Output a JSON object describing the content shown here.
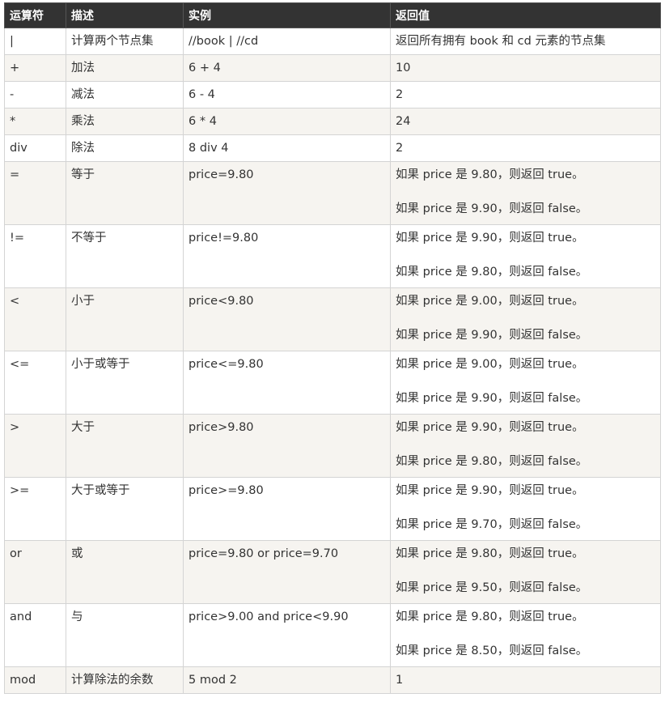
{
  "table": {
    "headers": [
      "运算符",
      "描述",
      "实例",
      "返回值"
    ],
    "rows": [
      {
        "op": "|",
        "desc": "计算两个节点集",
        "example": "//book | //cd",
        "returns": [
          "返回所有拥有 book 和 cd 元素的节点集"
        ]
      },
      {
        "op": "+",
        "desc": "加法",
        "example": "6 + 4",
        "returns": [
          "10"
        ]
      },
      {
        "op": "-",
        "desc": "减法",
        "example": "6 - 4",
        "returns": [
          "2"
        ]
      },
      {
        "op": "*",
        "desc": "乘法",
        "example": "6 * 4",
        "returns": [
          "24"
        ]
      },
      {
        "op": "div",
        "desc": "除法",
        "example": "8 div 4",
        "returns": [
          "2"
        ]
      },
      {
        "op": "=",
        "desc": "等于",
        "example": "price=9.80",
        "returns": [
          "如果 price 是 9.80，则返回 true。",
          "如果 price 是 9.90，则返回 false。"
        ]
      },
      {
        "op": "!=",
        "desc": "不等于",
        "example": "price!=9.80",
        "returns": [
          "如果 price 是 9.90，则返回 true。",
          "如果 price 是 9.80，则返回 false。"
        ]
      },
      {
        "op": "<",
        "desc": "小于",
        "example": "price<9.80",
        "returns": [
          "如果 price 是 9.00，则返回 true。",
          "如果 price 是 9.90，则返回 false。"
        ]
      },
      {
        "op": "<=",
        "desc": "小于或等于",
        "example": "price<=9.80",
        "returns": [
          "如果 price 是 9.00，则返回 true。",
          "如果 price 是 9.90，则返回 false。"
        ]
      },
      {
        "op": ">",
        "desc": "大于",
        "example": "price>9.80",
        "returns": [
          "如果 price 是 9.90，则返回 true。",
          "如果 price 是 9.80，则返回 false。"
        ]
      },
      {
        "op": ">=",
        "desc": "大于或等于",
        "example": "price>=9.80",
        "returns": [
          "如果 price 是 9.90，则返回 true。",
          "如果 price 是 9.70，则返回 false。"
        ]
      },
      {
        "op": "or",
        "desc": "或",
        "example": "price=9.80 or price=9.70",
        "returns": [
          "如果 price 是 9.80，则返回 true。",
          "如果 price 是 9.50，则返回 false。"
        ]
      },
      {
        "op": "and",
        "desc": "与",
        "example": "price>9.00 and price<9.90",
        "returns": [
          "如果 price 是 9.80，则返回 true。",
          "如果 price 是 8.50，则返回 false。"
        ]
      },
      {
        "op": "mod",
        "desc": "计算除法的余数",
        "example": "5 mod 2",
        "returns": [
          "1"
        ]
      }
    ]
  }
}
